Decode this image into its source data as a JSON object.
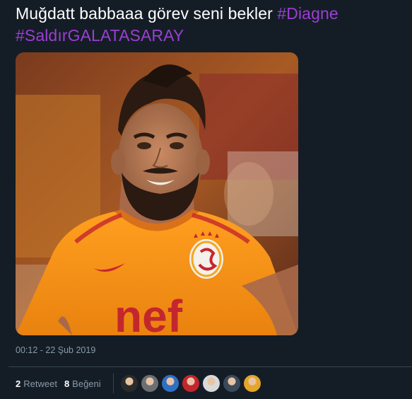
{
  "tweet": {
    "text_lead": "Muğdatt babbaaa görev seni bekler ",
    "hashtag_1": "#Diagne",
    "hashtag_2": "#SaldırGALATASARAY",
    "timestamp": "00:12 - 22 Şub 2019"
  },
  "media": {
    "alt": "Galatasaray player in orange jersey",
    "jersey_text": "nef"
  },
  "stats": {
    "retweet_count": "2",
    "retweet_label": "Retweet",
    "like_count": "8",
    "like_label": "Beğeni"
  },
  "avatars": [
    {
      "name": "avatar-1",
      "color": "#2b2b2b"
    },
    {
      "name": "avatar-2",
      "color": "#6a6f74"
    },
    {
      "name": "avatar-3",
      "color": "#2f6fc6"
    },
    {
      "name": "avatar-4",
      "color": "#c4262e"
    },
    {
      "name": "avatar-5",
      "color": "#d9d9d9"
    },
    {
      "name": "avatar-6",
      "color": "#3b4a5a"
    },
    {
      "name": "avatar-7",
      "color": "#e3a62a"
    }
  ],
  "colors": {
    "background": "#141d26",
    "hashtag": "#9b3fd1",
    "muted": "#8899a6",
    "divider": "#38444d",
    "jersey": "#f59a1c"
  }
}
